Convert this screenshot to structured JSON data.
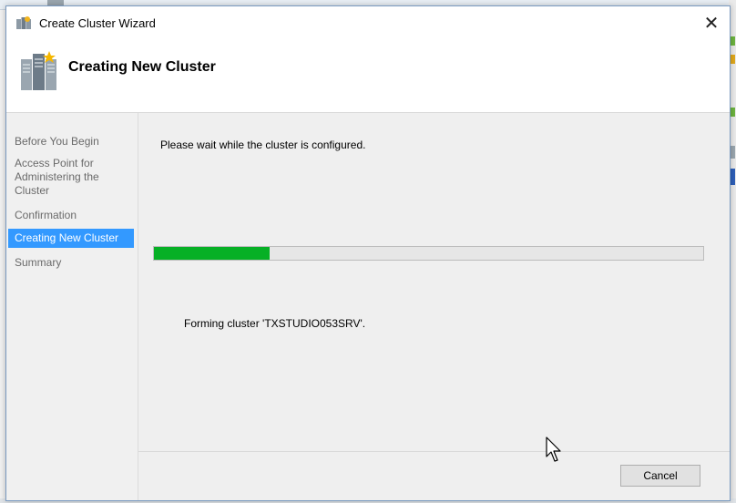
{
  "window": {
    "title": "Create Cluster Wizard",
    "close_glyph": "✕"
  },
  "header": {
    "heading": "Creating New Cluster",
    "icon": "cluster-server-icon"
  },
  "nav": {
    "items": [
      {
        "label": "Before You Begin"
      },
      {
        "label": "Access Point for Administering the Cluster"
      },
      {
        "label": "Confirmation"
      },
      {
        "label": "Creating New Cluster",
        "active": true
      },
      {
        "label": "Summary"
      }
    ]
  },
  "main": {
    "wait_text": "Please wait while the cluster is configured.",
    "progress_percent": 21,
    "status_text": "Forming cluster 'TXSTUDIO053SRV'."
  },
  "footer": {
    "cancel_label": "Cancel"
  },
  "colors": {
    "accent": "#3399ff",
    "progress": "#06b025"
  }
}
